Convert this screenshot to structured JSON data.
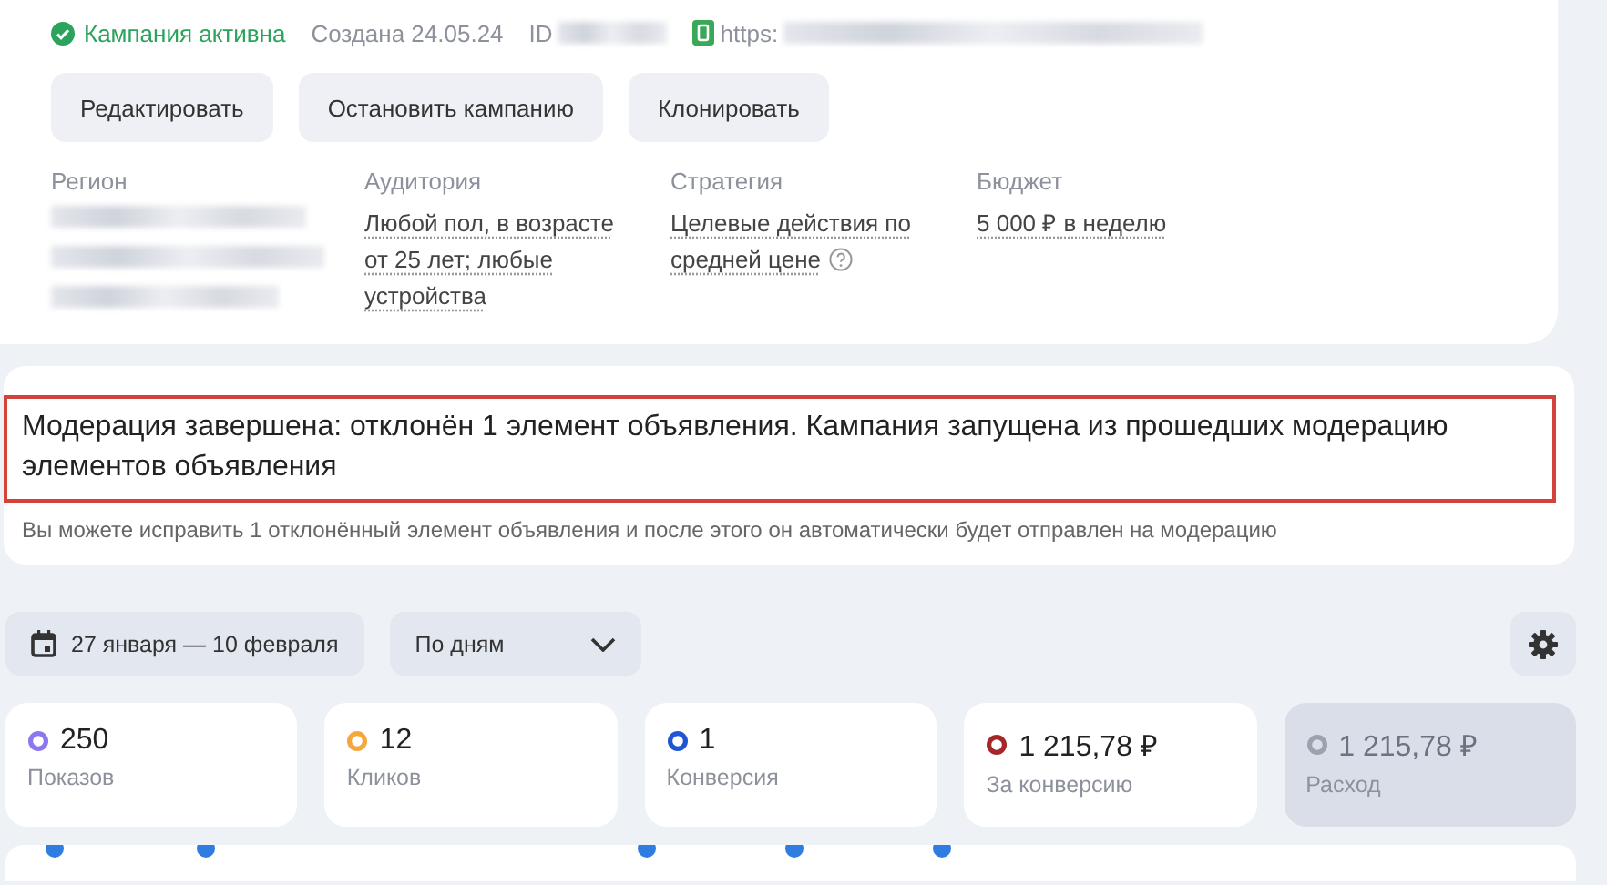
{
  "campaign": {
    "status": {
      "label": "Кампания активна",
      "active": true
    },
    "created": "Создана 24.05.24",
    "id_label": "ID",
    "link_prefix": "https:",
    "actions": [
      "Редактировать",
      "Остановить кампанию",
      "Клонировать"
    ],
    "details": [
      {
        "label": "Регион",
        "kind": "redacted"
      },
      {
        "label": "Аудитория",
        "kind": "link",
        "value": "Любой пол, в возрасте от 25 лет; любые устройства"
      },
      {
        "label": "Стратегия",
        "kind": "link",
        "value": "Целевые действия по средней цене",
        "help": true
      },
      {
        "label": "Бюджет",
        "kind": "link",
        "value": "5 000 ₽ в неделю"
      }
    ]
  },
  "moderation": {
    "title": "Модерация завершена: отклонён 1 элемент объявления. Кампания запущена из прошедших модерацию элементов объявления",
    "highlighted": true,
    "note": "Вы можете исправить 1 отклонённый элемент объявления и после этого он автоматически будет отправлен на модерацию"
  },
  "toolbar": {
    "date_range": "27 января — 10 февраля",
    "grouping": "По дням"
  },
  "metrics": [
    {
      "value": "250",
      "label": "Показов",
      "color": "#8a78f0",
      "selected": true
    },
    {
      "value": "12",
      "label": "Кликов",
      "color": "#f5a73b",
      "selected": true
    },
    {
      "value": "1",
      "label": "Конверсия",
      "color": "#1f56d6",
      "selected": true
    },
    {
      "value": "1 215,78 ₽",
      "label": "За конверсию",
      "color": "#a52828",
      "selected": true
    },
    {
      "value": "1 215,78 ₽",
      "label": "Расход",
      "color": "#9ba1ad",
      "selected": false
    }
  ]
}
